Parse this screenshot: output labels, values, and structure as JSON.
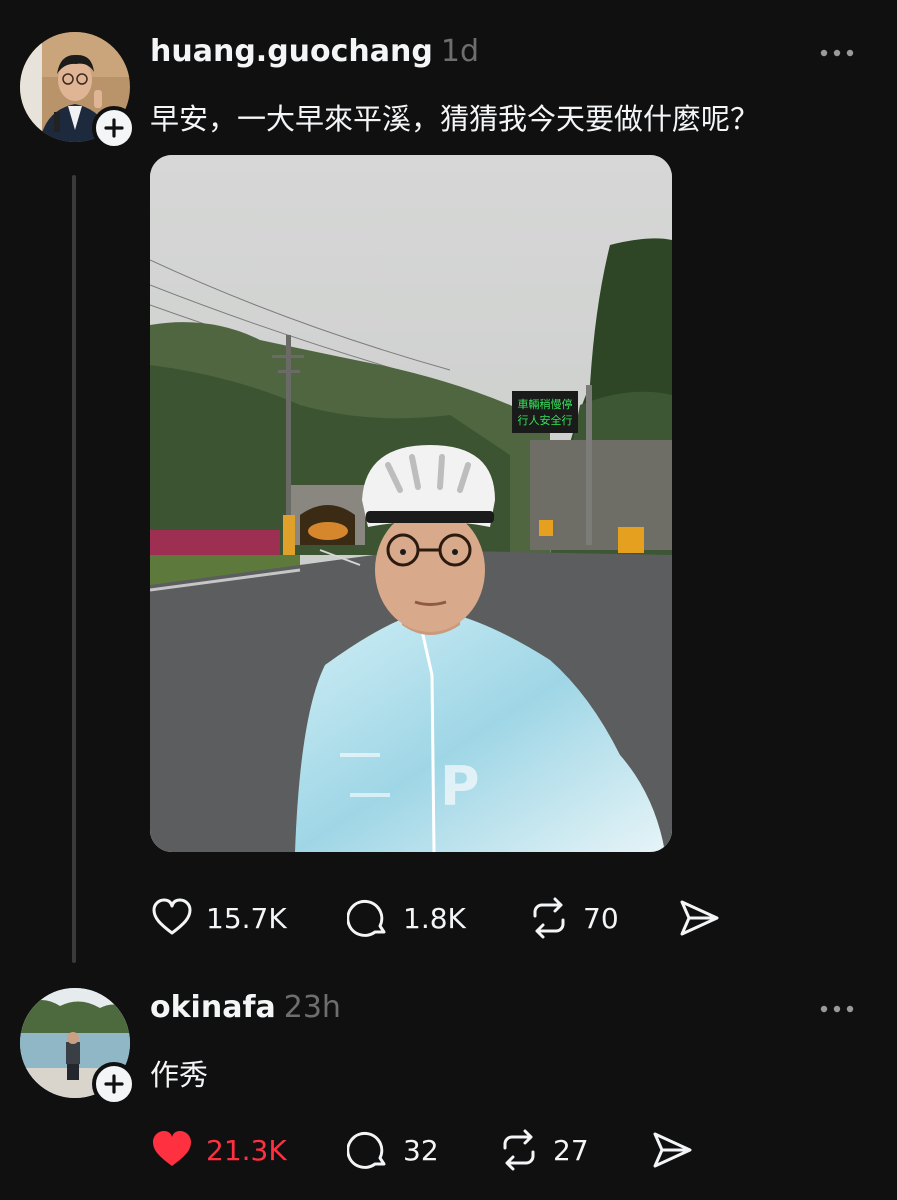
{
  "post": {
    "username": "huang.guochang",
    "time": "1d",
    "text": "早安，一大早來平溪，猜猜我今天要做什麼呢？",
    "sign": {
      "line1": "車輛稍慢停",
      "line2": "行人安全行"
    },
    "actions": {
      "likes": "15.7K",
      "replies": "1.8K",
      "reposts": "70"
    }
  },
  "reply": {
    "username": "okinafa",
    "time": "23h",
    "text": "作秀",
    "actions": {
      "likes": "21.3K",
      "replies": "32",
      "reposts": "27"
    }
  },
  "colors": {
    "background": "#101010",
    "text": "#f3f5f7",
    "muted": "#6e6e6e",
    "liked": "#ff3040"
  }
}
